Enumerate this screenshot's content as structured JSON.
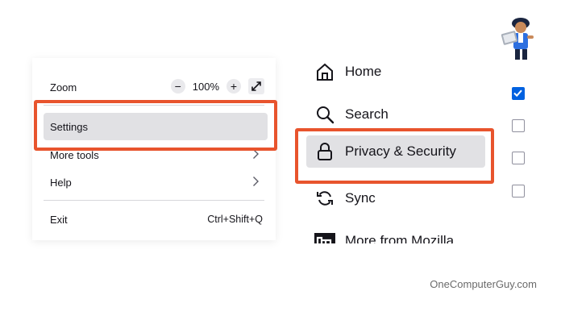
{
  "app_menu": {
    "zoom": {
      "label": "Zoom",
      "decrease_symbol": "−",
      "value": "100%",
      "increase_symbol": "+"
    },
    "settings": "Settings",
    "more_tools": "More tools",
    "help": "Help",
    "exit": {
      "label": "Exit",
      "shortcut": "Ctrl+Shift+Q"
    }
  },
  "settings_sidebar": {
    "items": [
      {
        "label": "Home",
        "icon": "home-icon"
      },
      {
        "label": "Search",
        "icon": "search-icon"
      },
      {
        "label": "Privacy & Security",
        "icon": "lock-icon",
        "selected": true
      },
      {
        "label": "Sync",
        "icon": "sync-icon"
      },
      {
        "label": "More from Mozilla",
        "icon": "mozilla-icon"
      }
    ]
  },
  "checkboxes": [
    {
      "checked": true
    },
    {
      "checked": false
    },
    {
      "checked": false
    },
    {
      "checked": false
    }
  ],
  "watermark": "OneComputerGuy.com",
  "colors": {
    "highlight": "#e8542d",
    "checkbox_checked": "#0061e0",
    "selected_bg": "#e1e1e4"
  }
}
